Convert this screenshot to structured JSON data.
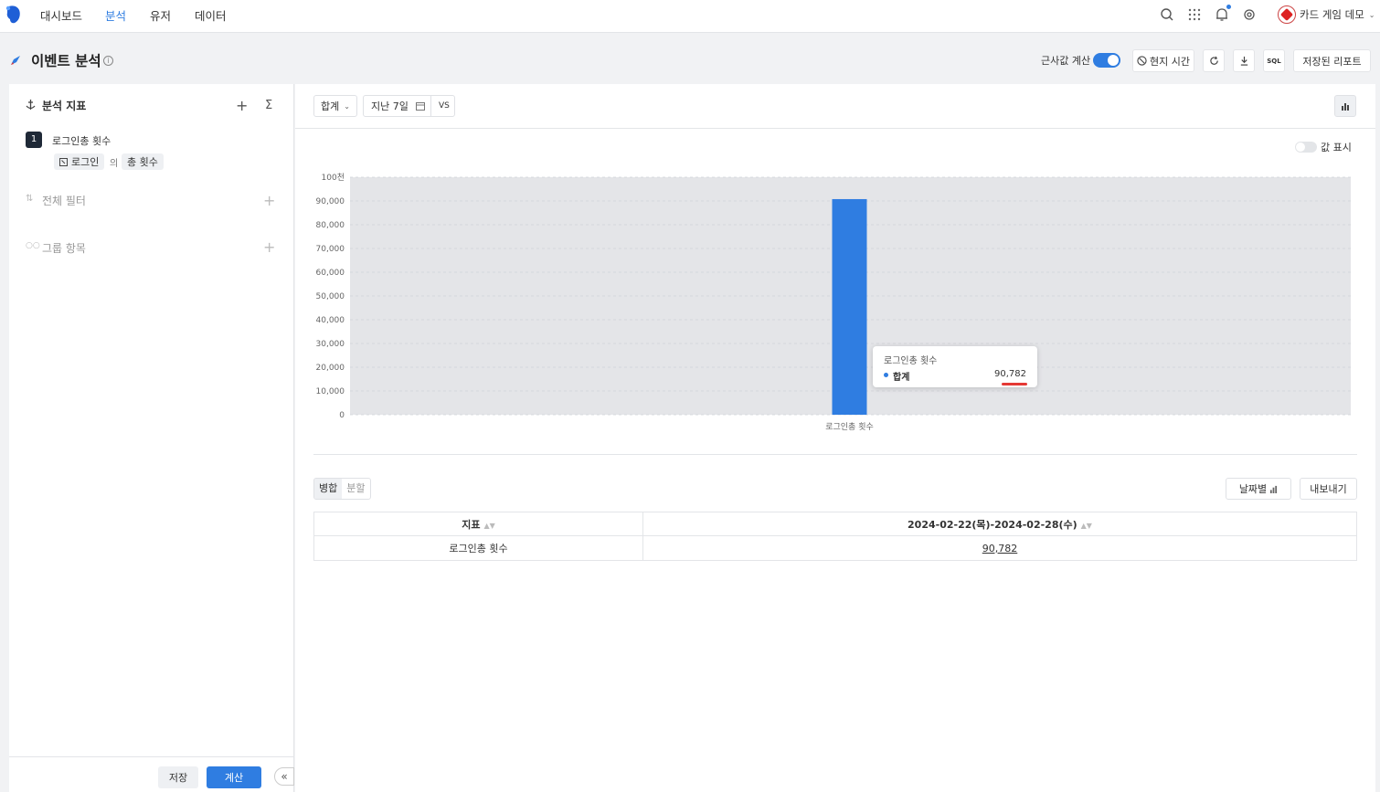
{
  "nav": {
    "items": [
      "대시보드",
      "분석",
      "유저",
      "데이터"
    ],
    "active_index": 1,
    "project_name": "카드 게임 데모",
    "icons": [
      "search-icon",
      "apps-grid-icon",
      "bell-icon",
      "settings-icon"
    ]
  },
  "header": {
    "title": "이벤트 분석",
    "approx_label": "근사값 계산",
    "approx_enabled": true,
    "local_time_label": "현지 시간",
    "sql_label": "SQL",
    "saved_reports_label": "저장된 리포트"
  },
  "left": {
    "metrics_title": "분석 지표",
    "metric": {
      "index": "1",
      "name": "로그인총 횟수",
      "event_chip": "로그인",
      "of_label": "의",
      "agg_chip": "총 횟수"
    },
    "filter_title": "전체 필터",
    "group_title": "그룹 항목",
    "save_label": "저장",
    "calc_label": "계산",
    "collapse_label": "«"
  },
  "controls": {
    "agg_select": "합계",
    "date_range": "지난 7일",
    "vs_label": "VS",
    "show_values_label": "값 표시",
    "show_values_enabled": false
  },
  "chart_data": {
    "type": "bar",
    "categories": [
      "로그인총 횟수"
    ],
    "series": [
      {
        "name": "합계",
        "values": [
          90782
        ]
      }
    ],
    "ylim": [
      0,
      100000
    ],
    "yticks": [
      "0",
      "10,000",
      "20,000",
      "30,000",
      "40,000",
      "50,000",
      "60,000",
      "70,000",
      "80,000",
      "90,000",
      "100천"
    ],
    "grid": true,
    "color": "#2f7de1",
    "tooltip": {
      "title": "로그인총 횟수",
      "series_name": "합계",
      "value": "90,782"
    }
  },
  "table": {
    "view_tabs": [
      "병합",
      "분할"
    ],
    "active_tab": 0,
    "by_date_label": "날짜별",
    "export_label": "내보내기",
    "columns": [
      "지표",
      "2024-02-22(목)-2024-02-28(수)"
    ],
    "rows": [
      [
        "로그인총 횟수",
        "90,782"
      ]
    ]
  }
}
